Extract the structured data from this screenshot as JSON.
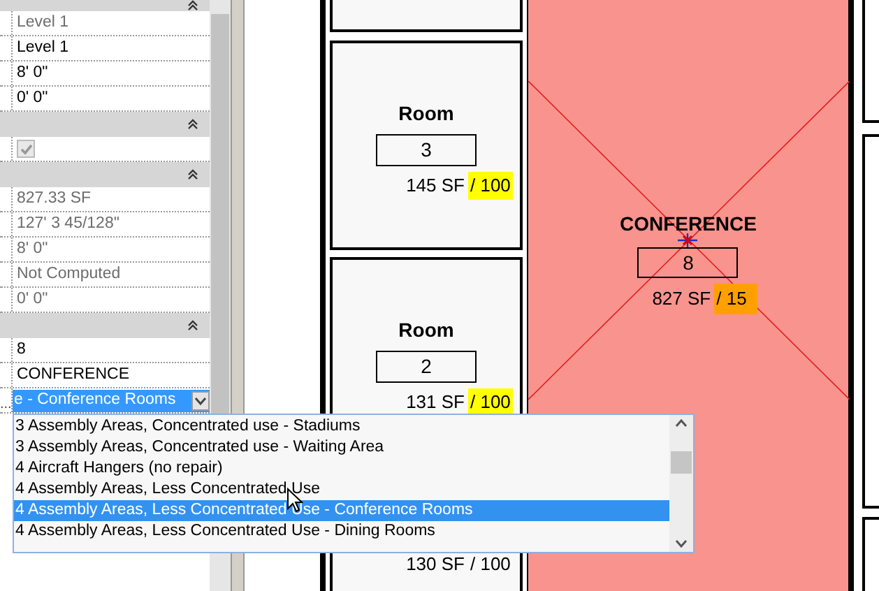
{
  "properties": {
    "groups": [
      {
        "expanded": true,
        "rows": [
          {
            "kind": "text",
            "value": "Level 1",
            "readonly": true
          },
          {
            "kind": "text",
            "value": "Level 1",
            "readonly": false
          },
          {
            "kind": "text",
            "value": "8'  0\"",
            "readonly": false
          },
          {
            "kind": "text",
            "value": "0'  0\"",
            "readonly": false
          }
        ]
      },
      {
        "expanded": true,
        "rows": [
          {
            "kind": "checkbox",
            "checked": true,
            "disabled": true
          }
        ]
      },
      {
        "expanded": true,
        "rows": [
          {
            "kind": "text",
            "value": "827.33 SF",
            "readonly": true
          },
          {
            "kind": "text",
            "value": "127'  3 45/128\"",
            "readonly": true
          },
          {
            "kind": "text",
            "value": "8'  0\"",
            "readonly": true
          },
          {
            "kind": "text",
            "value": "Not Computed",
            "readonly": true
          },
          {
            "kind": "text",
            "value": "0'  0\"",
            "readonly": true
          }
        ]
      },
      {
        "expanded": true,
        "rows": [
          {
            "kind": "text",
            "value": "8",
            "readonly": false
          },
          {
            "kind": "text",
            "value": "CONFERENCE",
            "readonly": false
          },
          {
            "kind": "dropdown",
            "label": "...",
            "value": "e - Conference Rooms",
            "open": true
          }
        ]
      }
    ]
  },
  "dropdown_list": {
    "options": [
      {
        "text": "3 Assembly Areas, Concentrated use - Stadiums",
        "selected": false
      },
      {
        "text": "3 Assembly Areas, Concentrated use - Waiting Area",
        "selected": false
      },
      {
        "text": "4 Aircraft Hangers (no repair)",
        "selected": false
      },
      {
        "text": "4 Assembly Areas, Less Concentrated Use",
        "selected": false
      },
      {
        "text": "4 Assembly Areas, Less Concentrated Use - Conference Rooms",
        "selected": true
      },
      {
        "text": "4 Assembly Areas, Less Concentrated Use - Dining Rooms",
        "selected": false
      }
    ]
  },
  "rooms": [
    {
      "name": "Room",
      "number": "3",
      "area": "145 SF",
      "load": "/ 100",
      "color": "#ffff00"
    },
    {
      "name": "Room",
      "number": "2",
      "area": "131 SF",
      "load": "/ 100",
      "color": "#ffff00"
    },
    {
      "area": "130 SF",
      "load": "/ 100"
    }
  ],
  "selected_room": {
    "name": "CONFERENCE",
    "number": "8",
    "area": "827 SF",
    "load": "/ 15",
    "color": "#ffa000"
  }
}
